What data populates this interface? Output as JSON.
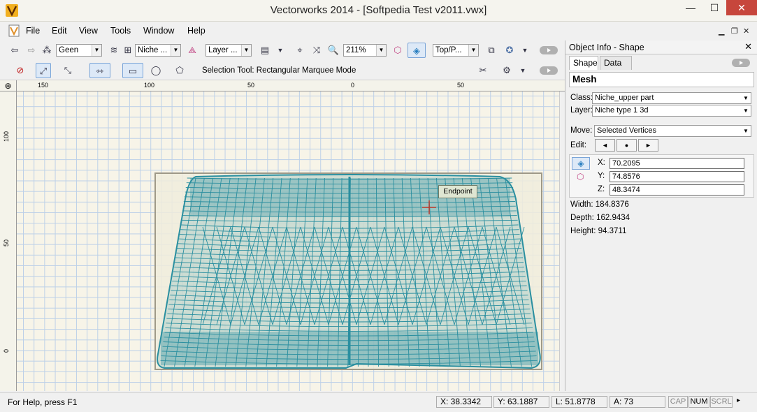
{
  "window": {
    "title": "Vectorworks 2014 - [Softpedia Test v2011.vwx]",
    "min_glyph": "—",
    "max_glyph": "☐",
    "close_glyph": "✕"
  },
  "menus": [
    "File",
    "Edit",
    "View",
    "Tools",
    "Window",
    "Help"
  ],
  "mdi_controls": {
    "minimize": "▁",
    "restore": "❐",
    "close": "✕"
  },
  "toolbar": {
    "class_combo": "Geen",
    "layer_class_combo": "Niche ...",
    "layer_combo": "Layer ...",
    "zoom_combo": "211%",
    "view_combo": "Top/P...",
    "status_text": "Selection Tool: Rectangular Marquee Mode"
  },
  "rulers": {
    "top_labels": [
      "150",
      "100",
      "50",
      "0",
      "50"
    ],
    "left_labels": [
      "100",
      "50",
      "0"
    ]
  },
  "canvas": {
    "tooltip": "Endpoint",
    "mesh_color": "#2a8fa0"
  },
  "object_info": {
    "title": "Object Info - Shape",
    "tabs": [
      "Shape",
      "Data"
    ],
    "shape_type": "Mesh",
    "class_label": "Class:",
    "class_value": "Niche_upper part",
    "layer_label": "Layer:",
    "layer_value": "Niche type 1 3d",
    "move_label": "Move:",
    "move_value": "Selected Vertices",
    "edit_label": "Edit:",
    "x_label": "X:",
    "x_value": "70.2095",
    "y_label": "Y:",
    "y_value": "74.8576",
    "z_label": "Z:",
    "z_value": "48.3474",
    "width_text": "Width:  184.8376",
    "depth_text": "Depth:  162.9434",
    "height_text": "Height: 94.3711"
  },
  "status": {
    "help": "For Help, press F1",
    "x": "X: 38.3342",
    "y": "Y: 63.1887",
    "l": "L: 51.8778",
    "a": "A: 73",
    "cap": "CAP",
    "num": "NUM",
    "scrl": "SCRL"
  }
}
